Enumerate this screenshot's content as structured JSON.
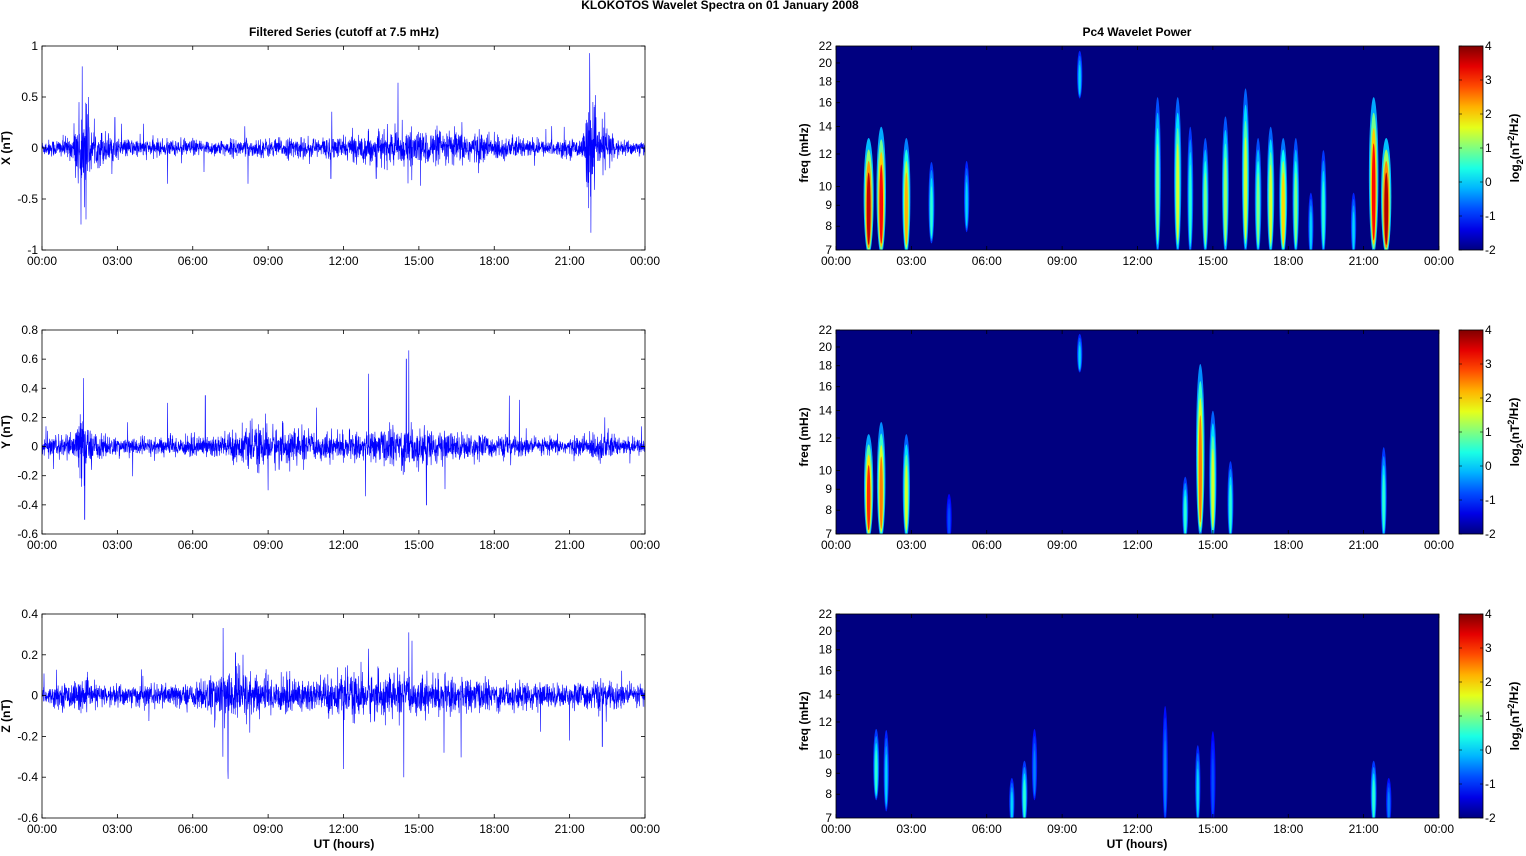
{
  "title": "KLOKOTOS Wavelet Spectra on 01 January   2008",
  "left_title": "Filtered Series (cutoff at 7.5 mHz)",
  "right_title": "Pc4 Wavelet Power",
  "xlabel": "UT (hours)",
  "freq_label": "freq (mHz)",
  "colorbar_label": {
    "a": "log",
    "b": "2",
    "c": "(nT",
    "d": "2",
    "e": "/Hz)"
  },
  "colors": {
    "trace": "#0000ff"
  },
  "chart_data": [
    {
      "type": "line",
      "name": "X",
      "ylabel": "X (nT)",
      "ylim": [
        -1,
        1
      ],
      "yticks": [
        "-1",
        "-0.5",
        "0",
        "0.5",
        "1"
      ],
      "ytick_values": [
        -1,
        -0.5,
        0,
        0.5,
        1
      ],
      "xticks": [
        "00:00",
        "03:00",
        "06:00",
        "09:00",
        "12:00",
        "15:00",
        "18:00",
        "21:00",
        "00:00"
      ],
      "xlim_hours": [
        0,
        24
      ],
      "envelope": [
        [
          0,
          0.04
        ],
        [
          1.2,
          0.06
        ],
        [
          1.5,
          0.25
        ],
        [
          1.7,
          0.3
        ],
        [
          2.0,
          0.08
        ],
        [
          2.4,
          0.1
        ],
        [
          3,
          0.05
        ],
        [
          6,
          0.04
        ],
        [
          9,
          0.05
        ],
        [
          12,
          0.06
        ],
        [
          13.5,
          0.09
        ],
        [
          15,
          0.09
        ],
        [
          17,
          0.09
        ],
        [
          18.5,
          0.06
        ],
        [
          20,
          0.04
        ],
        [
          21.5,
          0.05
        ],
        [
          21.8,
          0.3
        ],
        [
          22.1,
          0.1
        ],
        [
          22.5,
          0.12
        ],
        [
          23,
          0.04
        ],
        [
          24,
          0.04
        ]
      ],
      "spikes": [
        [
          1.6,
          0.8
        ],
        [
          1.55,
          -0.75
        ],
        [
          1.75,
          -0.7
        ],
        [
          2.9,
          0.3
        ],
        [
          21.8,
          0.93
        ],
        [
          21.85,
          -0.83
        ],
        [
          22.4,
          0.35
        ],
        [
          5.0,
          -0.35
        ],
        [
          8.2,
          -0.35
        ],
        [
          11.5,
          -0.3
        ],
        [
          13.3,
          -0.3
        ]
      ]
    },
    {
      "type": "line",
      "name": "Y",
      "ylabel": "Y (nT)",
      "ylim": [
        -0.6,
        0.8
      ],
      "yticks": [
        "-0.6",
        "-0.4",
        "-0.2",
        "0",
        "0.2",
        "0.4",
        "0.6",
        "0.8"
      ],
      "ytick_values": [
        -0.6,
        -0.4,
        -0.2,
        0,
        0.2,
        0.4,
        0.6,
        0.8
      ],
      "xticks": [
        "00:00",
        "03:00",
        "06:00",
        "09:00",
        "12:00",
        "15:00",
        "18:00",
        "21:00",
        "00:00"
      ],
      "xlim_hours": [
        0,
        24
      ],
      "envelope": [
        [
          0,
          0.03
        ],
        [
          1.3,
          0.05
        ],
        [
          1.6,
          0.15
        ],
        [
          1.9,
          0.06
        ],
        [
          3,
          0.03
        ],
        [
          6,
          0.04
        ],
        [
          8,
          0.06
        ],
        [
          9,
          0.08
        ],
        [
          11,
          0.05
        ],
        [
          13,
          0.05
        ],
        [
          14.5,
          0.09
        ],
        [
          15.5,
          0.06
        ],
        [
          18,
          0.04
        ],
        [
          21,
          0.03
        ],
        [
          22.4,
          0.06
        ],
        [
          23,
          0.03
        ],
        [
          24,
          0.03
        ]
      ],
      "spikes": [
        [
          1.65,
          0.47
        ],
        [
          1.7,
          -0.5
        ],
        [
          14.6,
          0.66
        ],
        [
          14.5,
          0.6
        ],
        [
          15.3,
          -0.4
        ],
        [
          13.0,
          0.5
        ],
        [
          9.0,
          -0.3
        ],
        [
          5.0,
          0.3
        ],
        [
          6.5,
          0.35
        ],
        [
          18.6,
          0.35
        ],
        [
          19.0,
          0.32
        ],
        [
          22.4,
          0.2
        ]
      ]
    },
    {
      "type": "line",
      "name": "Z",
      "ylabel": "Z (nT)",
      "ylim": [
        -0.6,
        0.4
      ],
      "yticks": [
        "-0.6",
        "-0.4",
        "-0.2",
        "0",
        "0.2",
        "0.4"
      ],
      "ytick_values": [
        -0.6,
        -0.4,
        -0.2,
        0,
        0.2,
        0.4
      ],
      "xticks": [
        "00:00",
        "03:00",
        "06:00",
        "09:00",
        "12:00",
        "15:00",
        "18:00",
        "21:00",
        "00:00"
      ],
      "xlim_hours": [
        0,
        24
      ],
      "envelope": [
        [
          0,
          0.02
        ],
        [
          1.5,
          0.04
        ],
        [
          2,
          0.03
        ],
        [
          6,
          0.03
        ],
        [
          7,
          0.06
        ],
        [
          8,
          0.07
        ],
        [
          9,
          0.05
        ],
        [
          12,
          0.05
        ],
        [
          13,
          0.06
        ],
        [
          15,
          0.05
        ],
        [
          18,
          0.04
        ],
        [
          21,
          0.03
        ],
        [
          22,
          0.04
        ],
        [
          24,
          0.03
        ]
      ],
      "spikes": [
        [
          7.7,
          0.21
        ],
        [
          7.4,
          -0.37
        ],
        [
          7.2,
          -0.3
        ],
        [
          8.0,
          0.2
        ],
        [
          12.0,
          -0.36
        ],
        [
          13.0,
          0.23
        ],
        [
          14.6,
          0.31
        ],
        [
          14.4,
          -0.4
        ],
        [
          16.0,
          -0.28
        ],
        [
          22.3,
          -0.25
        ],
        [
          21.0,
          -0.22
        ]
      ]
    },
    {
      "type": "heatmap",
      "name": "X power",
      "ylabel": "freq (mHz)",
      "ylim_mHz": [
        7,
        22
      ],
      "yscale": "log",
      "yticks": [
        "7",
        "8",
        "9",
        "10",
        "12",
        "14",
        "16",
        "18",
        "20",
        "22"
      ],
      "ytick_values": [
        7,
        8,
        9,
        10,
        12,
        14,
        16,
        18,
        20,
        22
      ],
      "xticks": [
        "00:00",
        "03:00",
        "06:00",
        "09:00",
        "12:00",
        "15:00",
        "18:00",
        "21:00",
        "00:00"
      ],
      "clim": [
        -2,
        4
      ],
      "colorbar_ticks": [
        "-2",
        "-1",
        "0",
        "1",
        "2",
        "3",
        "4"
      ],
      "bursts": [
        [
          1.3,
          7,
          14,
          3.6
        ],
        [
          1.8,
          7,
          15,
          3.2
        ],
        [
          2.8,
          7,
          14,
          2.2
        ],
        [
          3.8,
          7.5,
          12,
          0.5
        ],
        [
          5.2,
          8,
          12,
          0
        ],
        [
          9.7,
          17,
          22,
          0
        ],
        [
          12.8,
          7,
          18,
          1
        ],
        [
          13.6,
          7,
          18,
          1.5
        ],
        [
          14.1,
          7,
          15,
          0.5
        ],
        [
          14.7,
          7,
          14,
          1
        ],
        [
          15.5,
          7,
          16,
          1.2
        ],
        [
          16.3,
          7,
          19,
          1.5
        ],
        [
          16.8,
          7,
          14,
          1
        ],
        [
          17.3,
          7,
          15,
          1.5
        ],
        [
          17.8,
          7,
          14,
          2
        ],
        [
          18.3,
          7,
          14,
          1
        ],
        [
          18.9,
          7,
          10,
          0
        ],
        [
          19.4,
          7,
          13,
          0.5
        ],
        [
          20.6,
          7,
          10,
          0
        ],
        [
          21.4,
          7,
          18,
          3.2
        ],
        [
          21.9,
          7,
          14,
          3.7
        ]
      ]
    },
    {
      "type": "heatmap",
      "name": "Y power",
      "ylabel": "freq (mHz)",
      "ylim_mHz": [
        7,
        22
      ],
      "yscale": "log",
      "yticks": [
        "7",
        "8",
        "9",
        "10",
        "12",
        "14",
        "16",
        "18",
        "20",
        "22"
      ],
      "ytick_values": [
        7,
        8,
        9,
        10,
        12,
        14,
        16,
        18,
        20,
        22
      ],
      "xticks": [
        "00:00",
        "03:00",
        "06:00",
        "09:00",
        "12:00",
        "15:00",
        "18:00",
        "21:00",
        "00:00"
      ],
      "clim": [
        -2,
        4
      ],
      "colorbar_ticks": [
        "-2",
        "-1",
        "0",
        "1",
        "2",
        "3",
        "4"
      ],
      "bursts": [
        [
          1.3,
          7,
          13,
          3
        ],
        [
          1.8,
          7,
          14,
          2.5
        ],
        [
          2.8,
          7,
          13,
          1.5
        ],
        [
          4.5,
          7,
          9,
          -0.8
        ],
        [
          9.7,
          18,
          22,
          0
        ],
        [
          13.9,
          7,
          10,
          0.5
        ],
        [
          14.5,
          7,
          20,
          2.5
        ],
        [
          15.0,
          7,
          15,
          1.5
        ],
        [
          15.7,
          7,
          11,
          0.5
        ],
        [
          21.8,
          7,
          12,
          0.5
        ]
      ]
    },
    {
      "type": "heatmap",
      "name": "Z power",
      "ylabel": "freq (mHz)",
      "ylim_mHz": [
        7,
        22
      ],
      "yscale": "log",
      "yticks": [
        "7",
        "8",
        "9",
        "10",
        "12",
        "14",
        "16",
        "18",
        "20",
        "22"
      ],
      "ytick_values": [
        7,
        8,
        9,
        10,
        12,
        14,
        16,
        18,
        20,
        22
      ],
      "xticks": [
        "00:00",
        "03:00",
        "06:00",
        "09:00",
        "12:00",
        "15:00",
        "18:00",
        "21:00",
        "00:00"
      ],
      "clim": [
        -2,
        4
      ],
      "colorbar_ticks": [
        "-2",
        "-1",
        "0",
        "1",
        "2",
        "3",
        "4"
      ],
      "bursts": [
        [
          1.6,
          8,
          12,
          0.5
        ],
        [
          2.0,
          7.5,
          12,
          0
        ],
        [
          7.0,
          7,
          9,
          0
        ],
        [
          7.5,
          7,
          10,
          0.5
        ],
        [
          7.9,
          8,
          12,
          -0.5
        ],
        [
          13.1,
          7,
          14,
          -0.5
        ],
        [
          14.4,
          7,
          11,
          0
        ],
        [
          15.0,
          7,
          12,
          -0.8
        ],
        [
          21.4,
          7,
          10,
          0.5
        ],
        [
          22.0,
          7,
          9,
          -0.5
        ]
      ]
    }
  ]
}
